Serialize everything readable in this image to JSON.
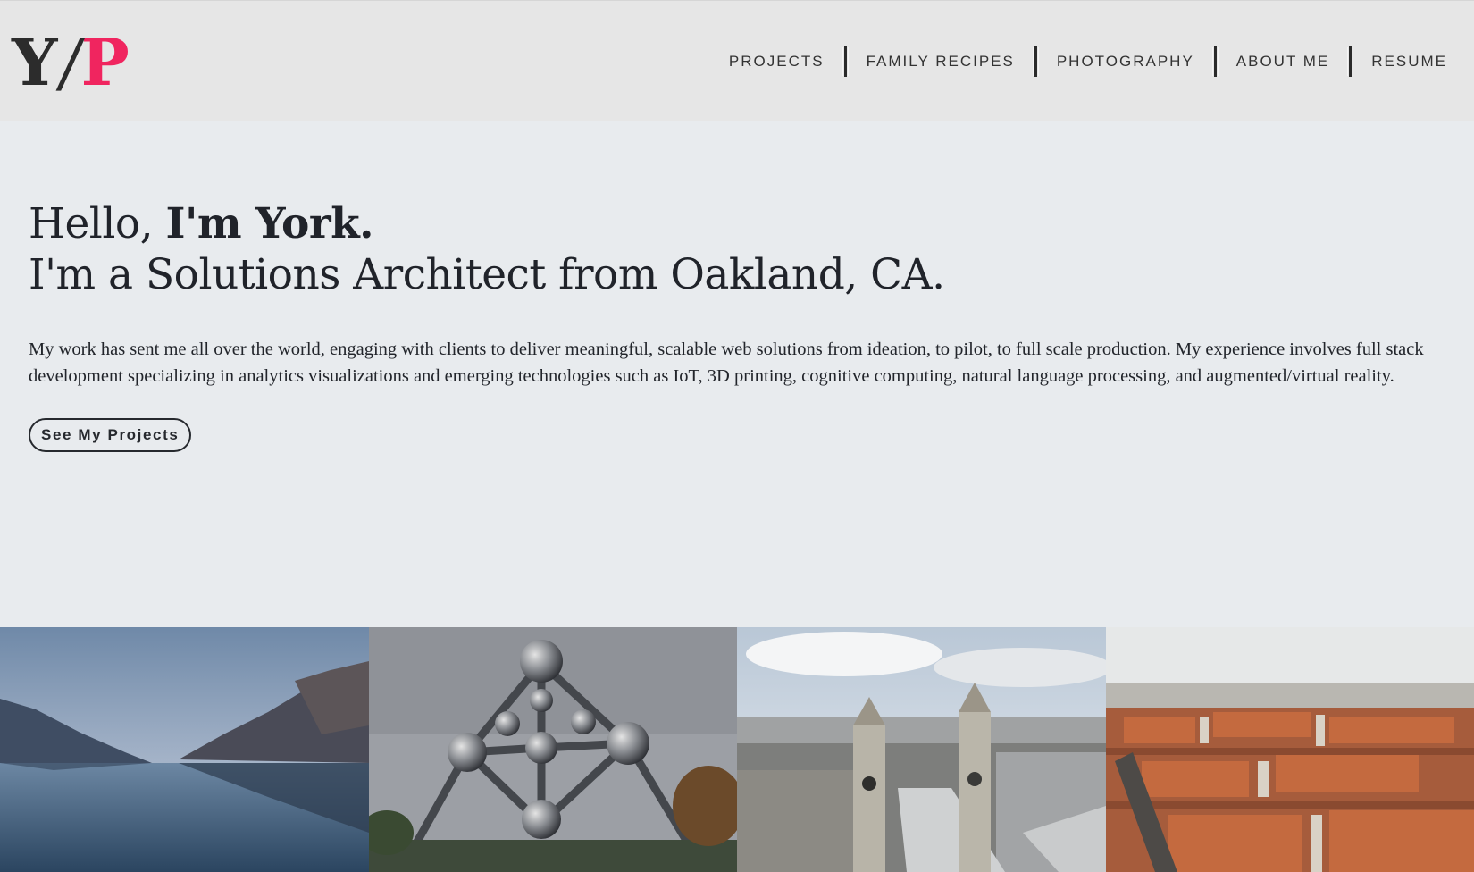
{
  "logo": {
    "y": "Y",
    "slash": "/",
    "p": "P"
  },
  "colors": {
    "accent": "#f0255f",
    "text": "#20232a",
    "header_bg": "#e6e6e6",
    "page_bg": "#e8ebee"
  },
  "nav": [
    {
      "label": "PROJECTS"
    },
    {
      "label": "FAMILY RECIPES"
    },
    {
      "label": "PHOTOGRAPHY"
    },
    {
      "label": "ABOUT ME"
    },
    {
      "label": "RESUME"
    }
  ],
  "hero": {
    "greeting": "Hello, ",
    "name": "I'm York.",
    "tagline": "I'm a Solutions Architect from Oakland, CA.",
    "bio": "My work has sent me all over the world, engaging with clients to deliver meaningful, scalable web solutions from ideation, to pilot, to full scale production. My experience involves full stack development specializing in analytics visualizations and emerging technologies such as IoT, 3D printing, cognitive computing, natural language processing, and augmented/virtual reality.",
    "cta": "See My Projects"
  },
  "photos": [
    {
      "subject": "lake-mountains-photo"
    },
    {
      "subject": "atomium-photo"
    },
    {
      "subject": "cathedral-city-photo"
    },
    {
      "subject": "rooftops-city-photo"
    }
  ]
}
